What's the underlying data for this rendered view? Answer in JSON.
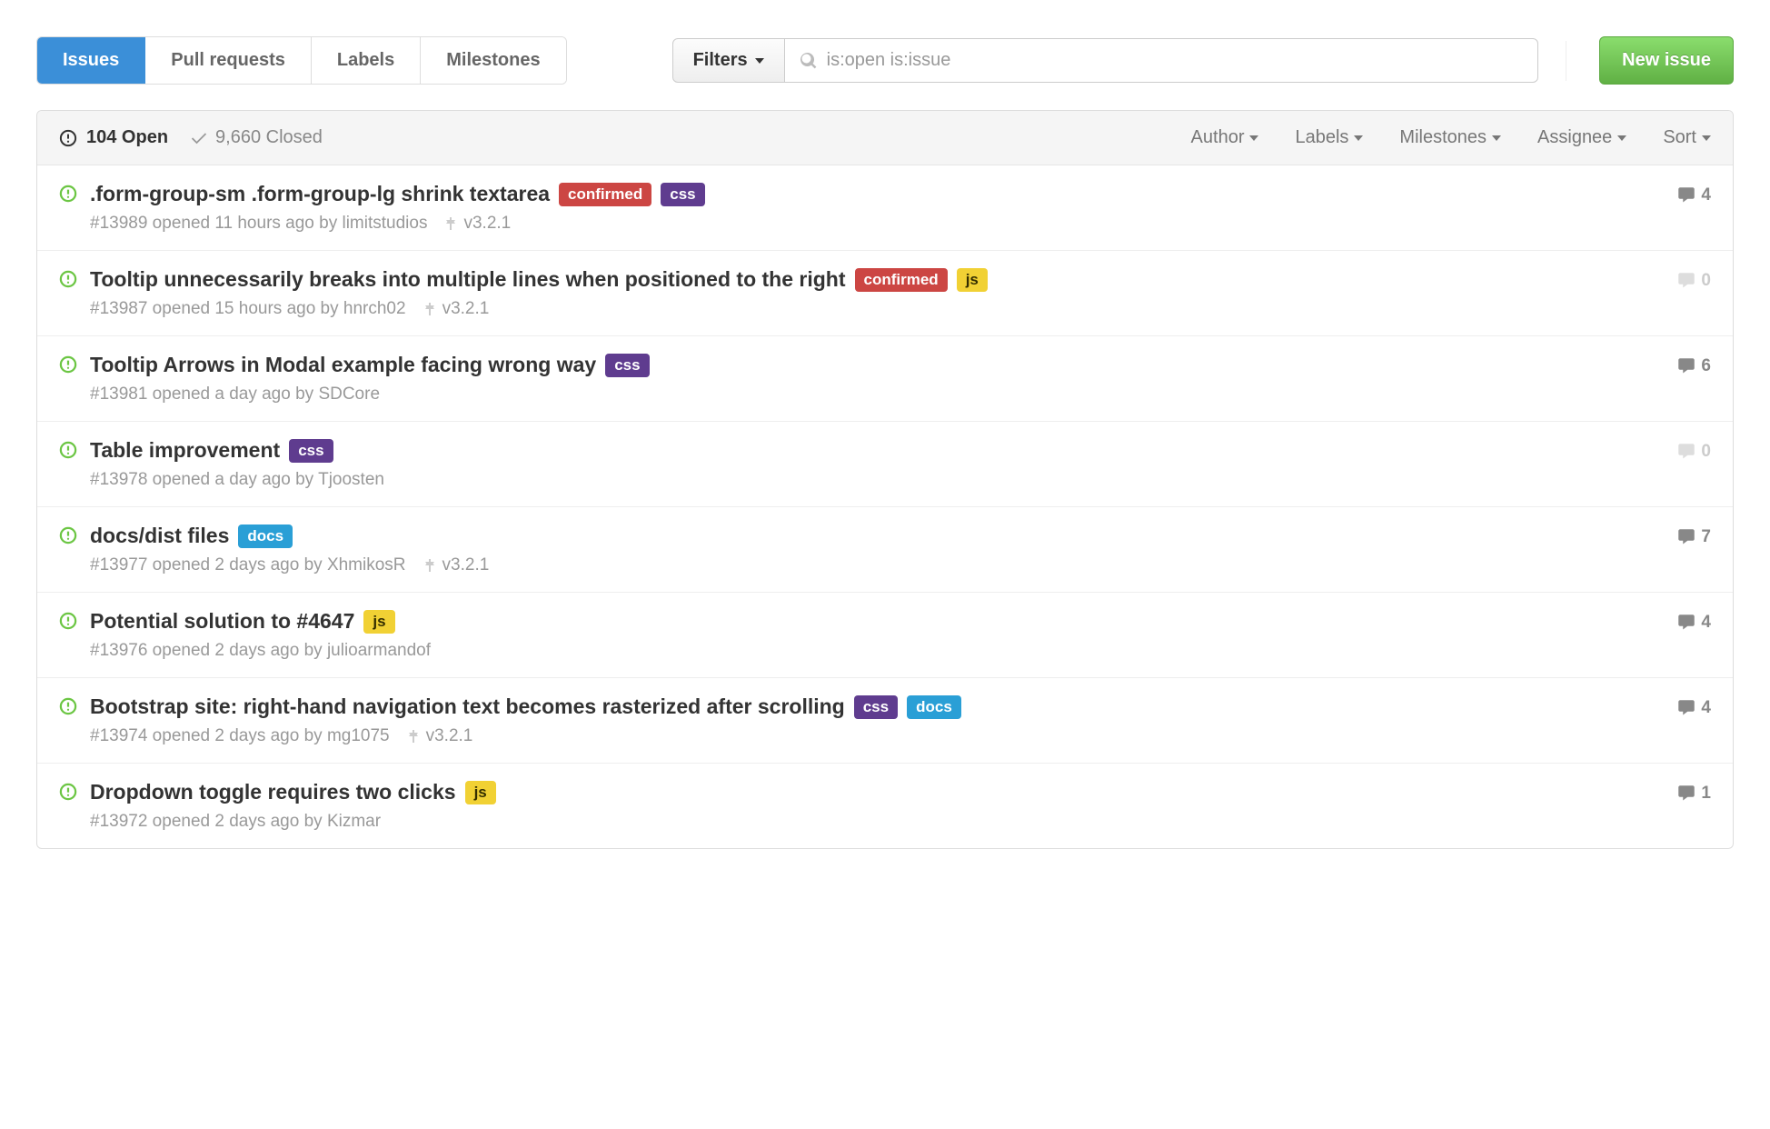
{
  "nav": {
    "issues": "Issues",
    "pulls": "Pull requests",
    "labels": "Labels",
    "milestones": "Milestones"
  },
  "filters_btn": "Filters",
  "search": {
    "value": "is:open is:issue"
  },
  "new_issue": "New issue",
  "header": {
    "open_count": "104 Open",
    "closed_count": "9,660 Closed",
    "author": "Author",
    "labels": "Labels",
    "milestones": "Milestones",
    "assignee": "Assignee",
    "sort": "Sort"
  },
  "label_colors": {
    "confirmed": "#cc4643",
    "css": "#5f3c8f",
    "js": "#f1d134",
    "docs": "#2a9fd6"
  },
  "label_text_colors": {
    "js": "#332e00"
  },
  "issues": [
    {
      "title": ".form-group-sm .form-group-lg shrink textarea",
      "labels": [
        "confirmed",
        "css"
      ],
      "meta": "#13989 opened 11 hours ago by limitstudios",
      "milestone": "v3.2.1",
      "comments": 4,
      "muted": false
    },
    {
      "title": "Tooltip unnecessarily breaks into multiple lines when positioned to the right",
      "labels": [
        "confirmed",
        "js"
      ],
      "meta": "#13987 opened 15 hours ago by hnrch02",
      "milestone": "v3.2.1",
      "comments": 0,
      "muted": true
    },
    {
      "title": "Tooltip Arrows in Modal example facing wrong way",
      "labels": [
        "css"
      ],
      "meta": "#13981 opened a day ago by SDCore",
      "milestone": null,
      "comments": 6,
      "muted": false
    },
    {
      "title": "Table improvement",
      "labels": [
        "css"
      ],
      "meta": "#13978 opened a day ago by Tjoosten",
      "milestone": null,
      "comments": 0,
      "muted": true
    },
    {
      "title": "docs/dist files",
      "labels": [
        "docs"
      ],
      "meta": "#13977 opened 2 days ago by XhmikosR",
      "milestone": "v3.2.1",
      "comments": 7,
      "muted": false
    },
    {
      "title": "Potential solution to #4647",
      "labels": [
        "js"
      ],
      "meta": "#13976 opened 2 days ago by julioarmandof",
      "milestone": null,
      "comments": 4,
      "muted": false
    },
    {
      "title": "Bootstrap site: right-hand navigation text becomes rasterized after scrolling",
      "labels": [
        "css",
        "docs"
      ],
      "meta": "#13974 opened 2 days ago by mg1075",
      "milestone": "v3.2.1",
      "comments": 4,
      "muted": false
    },
    {
      "title": "Dropdown toggle requires two clicks",
      "labels": [
        "js"
      ],
      "meta": "#13972 opened 2 days ago by Kizmar",
      "milestone": null,
      "comments": 1,
      "muted": false
    }
  ]
}
